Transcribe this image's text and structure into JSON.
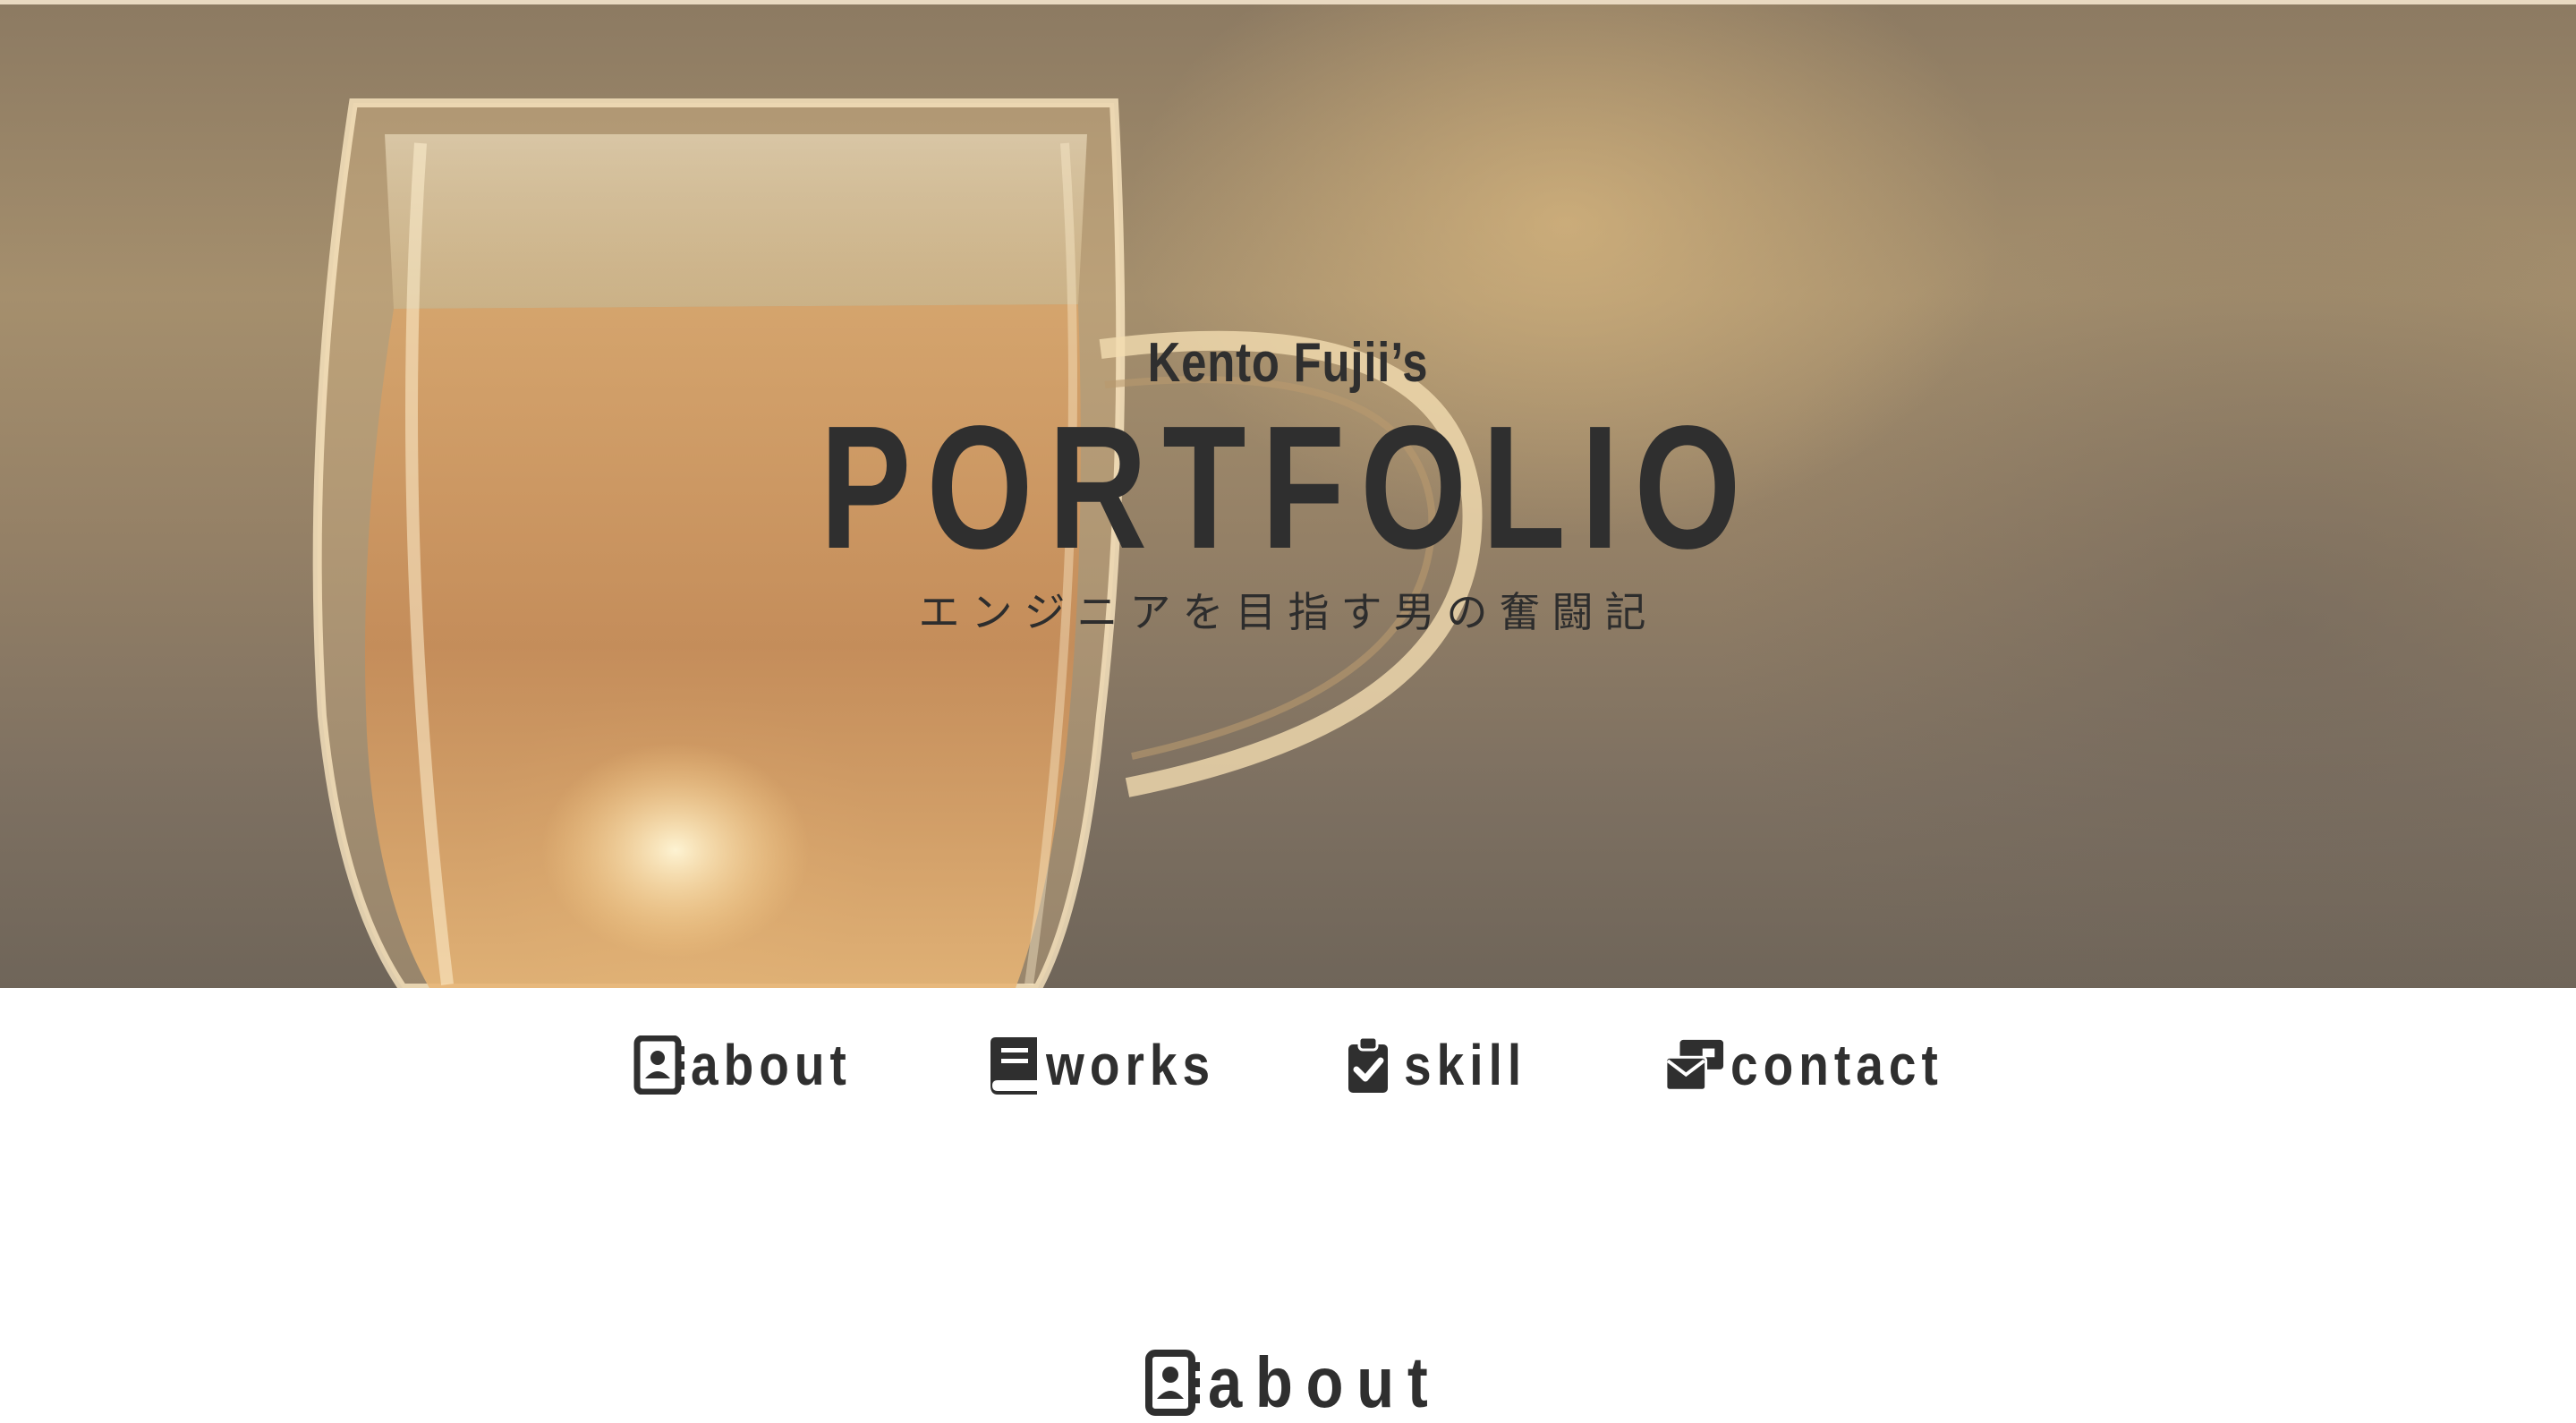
{
  "hero": {
    "kicker": "Kento Fujii’s",
    "title": "PORTFOLIO",
    "subtitle": "エンジニアを目指す男の奮闘記"
  },
  "nav": {
    "items": [
      {
        "label": "about",
        "icon": "address-book-icon"
      },
      {
        "label": "works",
        "icon": "book-icon"
      },
      {
        "label": "skill",
        "icon": "clipboard-check-icon"
      },
      {
        "label": "contact",
        "icon": "envelopes-icon"
      }
    ]
  },
  "sections": {
    "about_heading": "about",
    "about_icon": "address-book-icon"
  },
  "colors": {
    "text": "#2f2f2f",
    "background": "#ffffff"
  }
}
